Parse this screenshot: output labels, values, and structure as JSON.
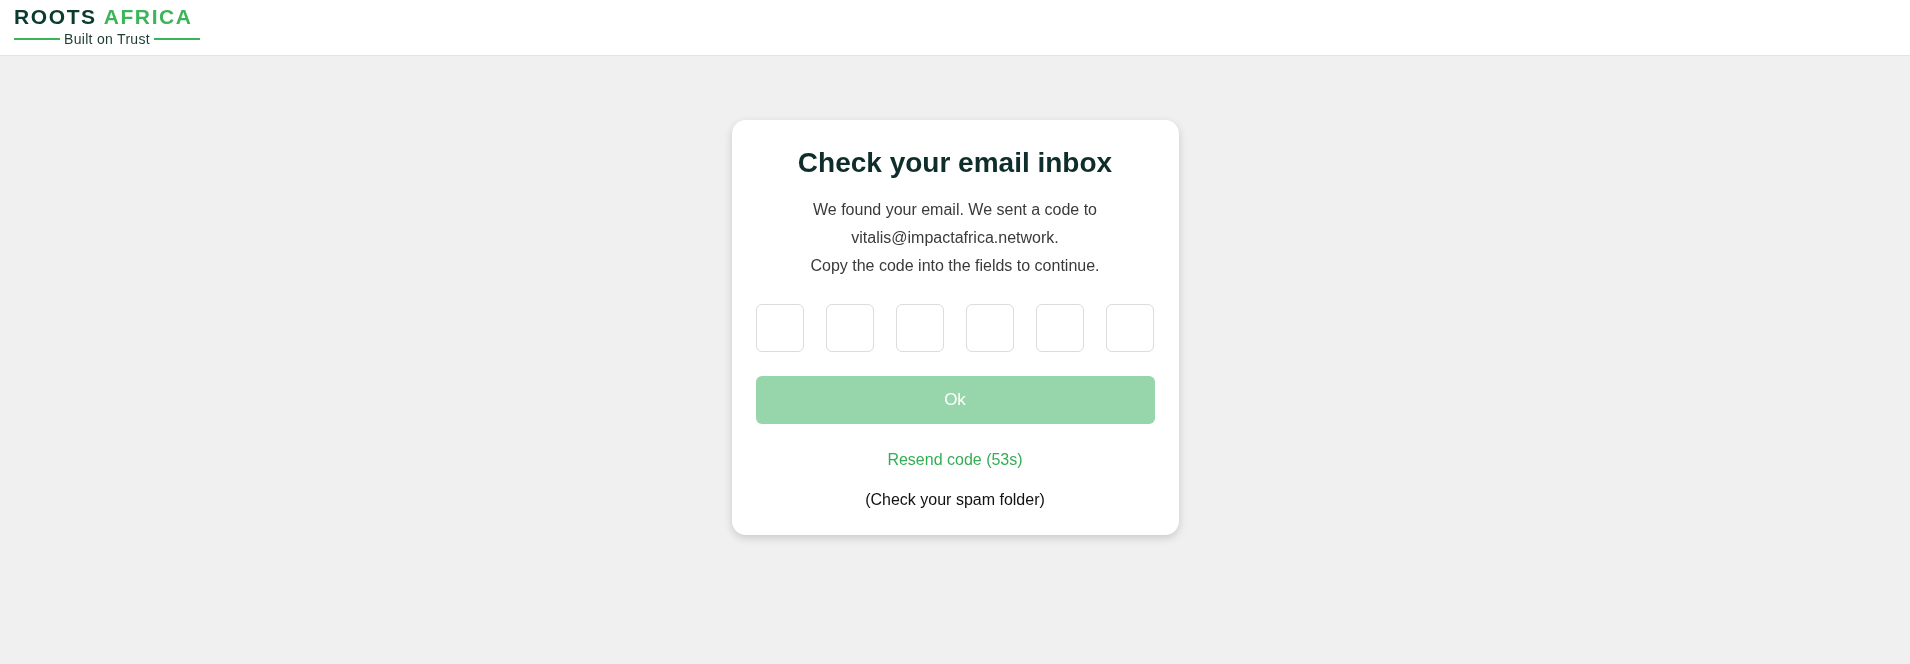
{
  "header": {
    "logo": {
      "name_parts": [
        {
          "text": "ROOTS",
          "color": "#0b3b2e"
        },
        {
          "text": "AFRICA",
          "color": "#3cb55a"
        }
      ],
      "tagline": "Built on Trust"
    }
  },
  "card": {
    "title": "Check your email inbox",
    "message_lines": [
      "We found your email. We sent a code to",
      "vitalis@impactafrica.network.",
      "Copy the code into the fields to continue."
    ],
    "code_fields": [
      {
        "focused": false
      },
      {
        "focused": false
      },
      {
        "focused": false
      },
      {
        "focused": false
      },
      {
        "focused": false
      },
      {
        "focused": false
      }
    ],
    "ok_button": {
      "label": "Ok",
      "disabled": true
    },
    "resend_link": "Resend code (53s)",
    "spam_note": "(Check your spam folder)"
  }
}
